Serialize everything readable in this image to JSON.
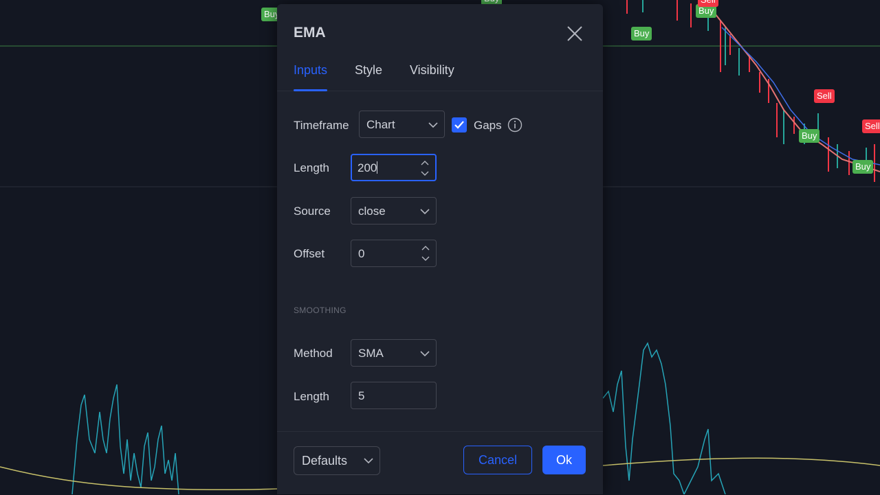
{
  "dialog": {
    "title": "EMA",
    "tabs": [
      {
        "label": "Inputs",
        "active": true
      },
      {
        "label": "Style",
        "active": false
      },
      {
        "label": "Visibility",
        "active": false
      }
    ]
  },
  "inputs": {
    "timeframe": {
      "label": "Timeframe",
      "value": "Chart"
    },
    "gaps": {
      "label": "Gaps",
      "checked": true
    },
    "length": {
      "label": "Length",
      "value": "200"
    },
    "source": {
      "label": "Source",
      "value": "close"
    },
    "offset": {
      "label": "Offset",
      "value": "0"
    }
  },
  "smoothing": {
    "section_title": "SMOOTHING",
    "method": {
      "label": "Method",
      "value": "SMA"
    },
    "length": {
      "label": "Length",
      "value": "5"
    }
  },
  "footer": {
    "defaults_label": "Defaults",
    "cancel_label": "Cancel",
    "ok_label": "Ok"
  },
  "chart_signals": [
    {
      "text": "Buy",
      "type": "buy"
    },
    {
      "text": "Buy",
      "type": "buy"
    },
    {
      "text": "Buy",
      "type": "buy"
    },
    {
      "text": "Sell",
      "type": "sell"
    },
    {
      "text": "Buy",
      "type": "buy"
    },
    {
      "text": "Sell",
      "type": "sell"
    },
    {
      "text": "Buy",
      "type": "buy"
    },
    {
      "text": "Sell",
      "type": "sell"
    },
    {
      "text": "Buy",
      "type": "buy"
    }
  ],
  "colors": {
    "background": "#131722",
    "dialog": "#1e222d",
    "accent": "#2962ff",
    "buy": "#4caf50",
    "sell": "#f23645",
    "oscillator": "#26a5b8",
    "signal_line": "#c9c26a"
  },
  "icons": {
    "close": "close-icon",
    "chevron": "chevron-down-icon",
    "check": "check-icon",
    "info": "info-icon",
    "spinner": "spinner-arrows-icon"
  }
}
